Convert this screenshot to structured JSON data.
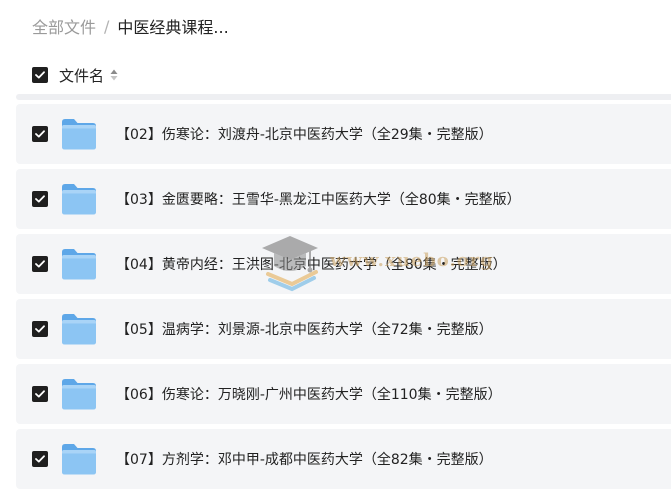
{
  "breadcrumb": {
    "root": "全部文件",
    "separator": "/",
    "current": "中医经典课程..."
  },
  "header": {
    "column_title": "文件名",
    "all_checked": true
  },
  "rows": [
    {
      "label": "【02】伤寒论：刘渡舟-北京中医药大学（全29集・完整版）",
      "checked": true
    },
    {
      "label": "【03】金匮要略：王雪华-黑龙江中医药大学（全80集・完整版）",
      "checked": true
    },
    {
      "label": "【04】黄帝内经：王洪图-北京中医药大学（全80集・完整版）",
      "checked": true
    },
    {
      "label": "【05】温病学：刘景源-北京中医药大学（全72集・完整版）",
      "checked": true
    },
    {
      "label": "【06】伤寒论：万晓刚-广州中医药大学（全110集・完整版）",
      "checked": true
    },
    {
      "label": "【07】方剂学：邓中甲-成都中医药大学（全82集・完整版）",
      "checked": true
    }
  ],
  "watermark": {
    "text": "www.xuebo.org"
  },
  "colors": {
    "checkbox": "#1f1f1f",
    "row_bg": "#f4f5f7",
    "folder": "#7fbdf0",
    "text": "#222222",
    "muted": "#9a9a9a"
  },
  "icons": {
    "checkbox": "checkmark-icon",
    "folder": "folder-icon",
    "sort": "sort-icon"
  }
}
